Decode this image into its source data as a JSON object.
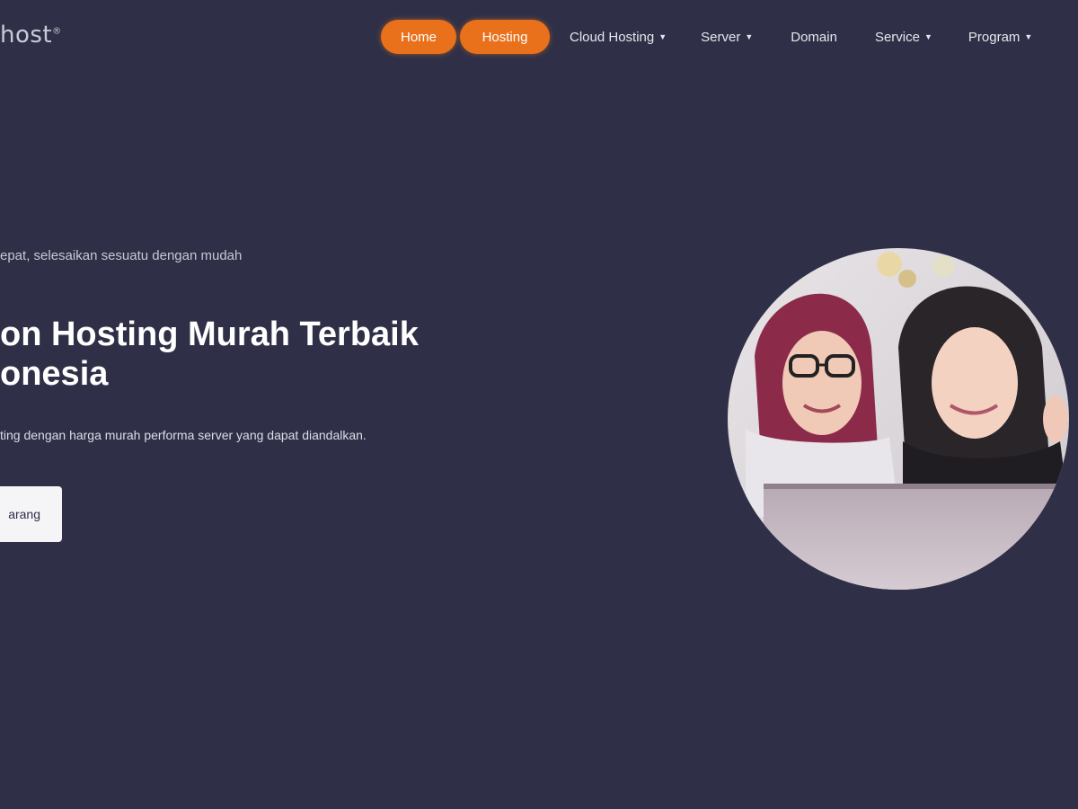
{
  "brand": {
    "logo_text": "host",
    "logo_mark": "®"
  },
  "nav": {
    "home_label": "Home",
    "hosting_label": "Hosting",
    "cloud_hosting_label": "Cloud Hosting",
    "server_label": "Server",
    "domain_label": "Domain",
    "service_label": "Service",
    "program_label": "Program",
    "dropdown_icon": "caret-down-icon",
    "accent_color": "#e9711c"
  },
  "hero": {
    "tagline": "epat, selesaikan sesuatu dengan mudah",
    "title_line1": "on Hosting Murah Terbaik",
    "title_line2": "onesia",
    "description": "ting dengan harga murah performa server yang dapat diandalkan.",
    "cta_label": "arang",
    "background_color": "#2f3047"
  }
}
